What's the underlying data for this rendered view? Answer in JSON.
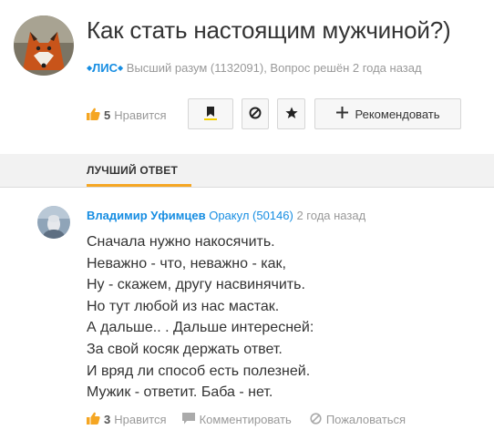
{
  "question": {
    "title": "Как стать настоящим мужчиной?)",
    "author": "ЛИС",
    "author_rank": "Высший разум (1132091), Вопрос решён 2 года назад",
    "likes_count": "5",
    "likes_label": "Нравится",
    "recommend_label": "Рекомендовать"
  },
  "best_answer": {
    "tab_label": "ЛУЧШИЙ ОТВЕТ",
    "author": "Владимир Уфимцев",
    "rank": "Оракул (50146)",
    "time": "2 года назад",
    "lines": [
      "Сначала нужно накосячить.",
      "Неважно - что, неважно - как,",
      "Ну - скажем, другу насвинячить.",
      "Но тут любой из нас мастак.",
      "А дальше.. . Дальше интересней:",
      "За свой косяк держать ответ.",
      "И вряд ли способ есть полезней.",
      "Мужик - ответит. Баба - нет."
    ],
    "likes_count": "3",
    "likes_label": "Нравится",
    "comment_label": "Комментировать",
    "report_label": "Пожаловаться"
  },
  "colors": {
    "link": "#168de2",
    "accent": "#f5a623",
    "muted": "#999999"
  }
}
